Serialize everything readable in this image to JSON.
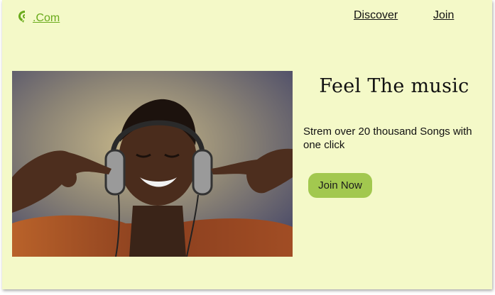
{
  "header": {
    "logo_text": ".Com",
    "nav": [
      {
        "label": "Discover"
      },
      {
        "label": "Join"
      }
    ]
  },
  "hero": {
    "image_icon": "music-listener-photo",
    "headline": "Feel The music",
    "subtext": "Strem over 20 thousand Songs with one click",
    "cta_label": "Join Now"
  },
  "colors": {
    "page_bg": "#f4f9c8",
    "brand_green": "#6aab1c",
    "button_green": "#a2c84f"
  }
}
